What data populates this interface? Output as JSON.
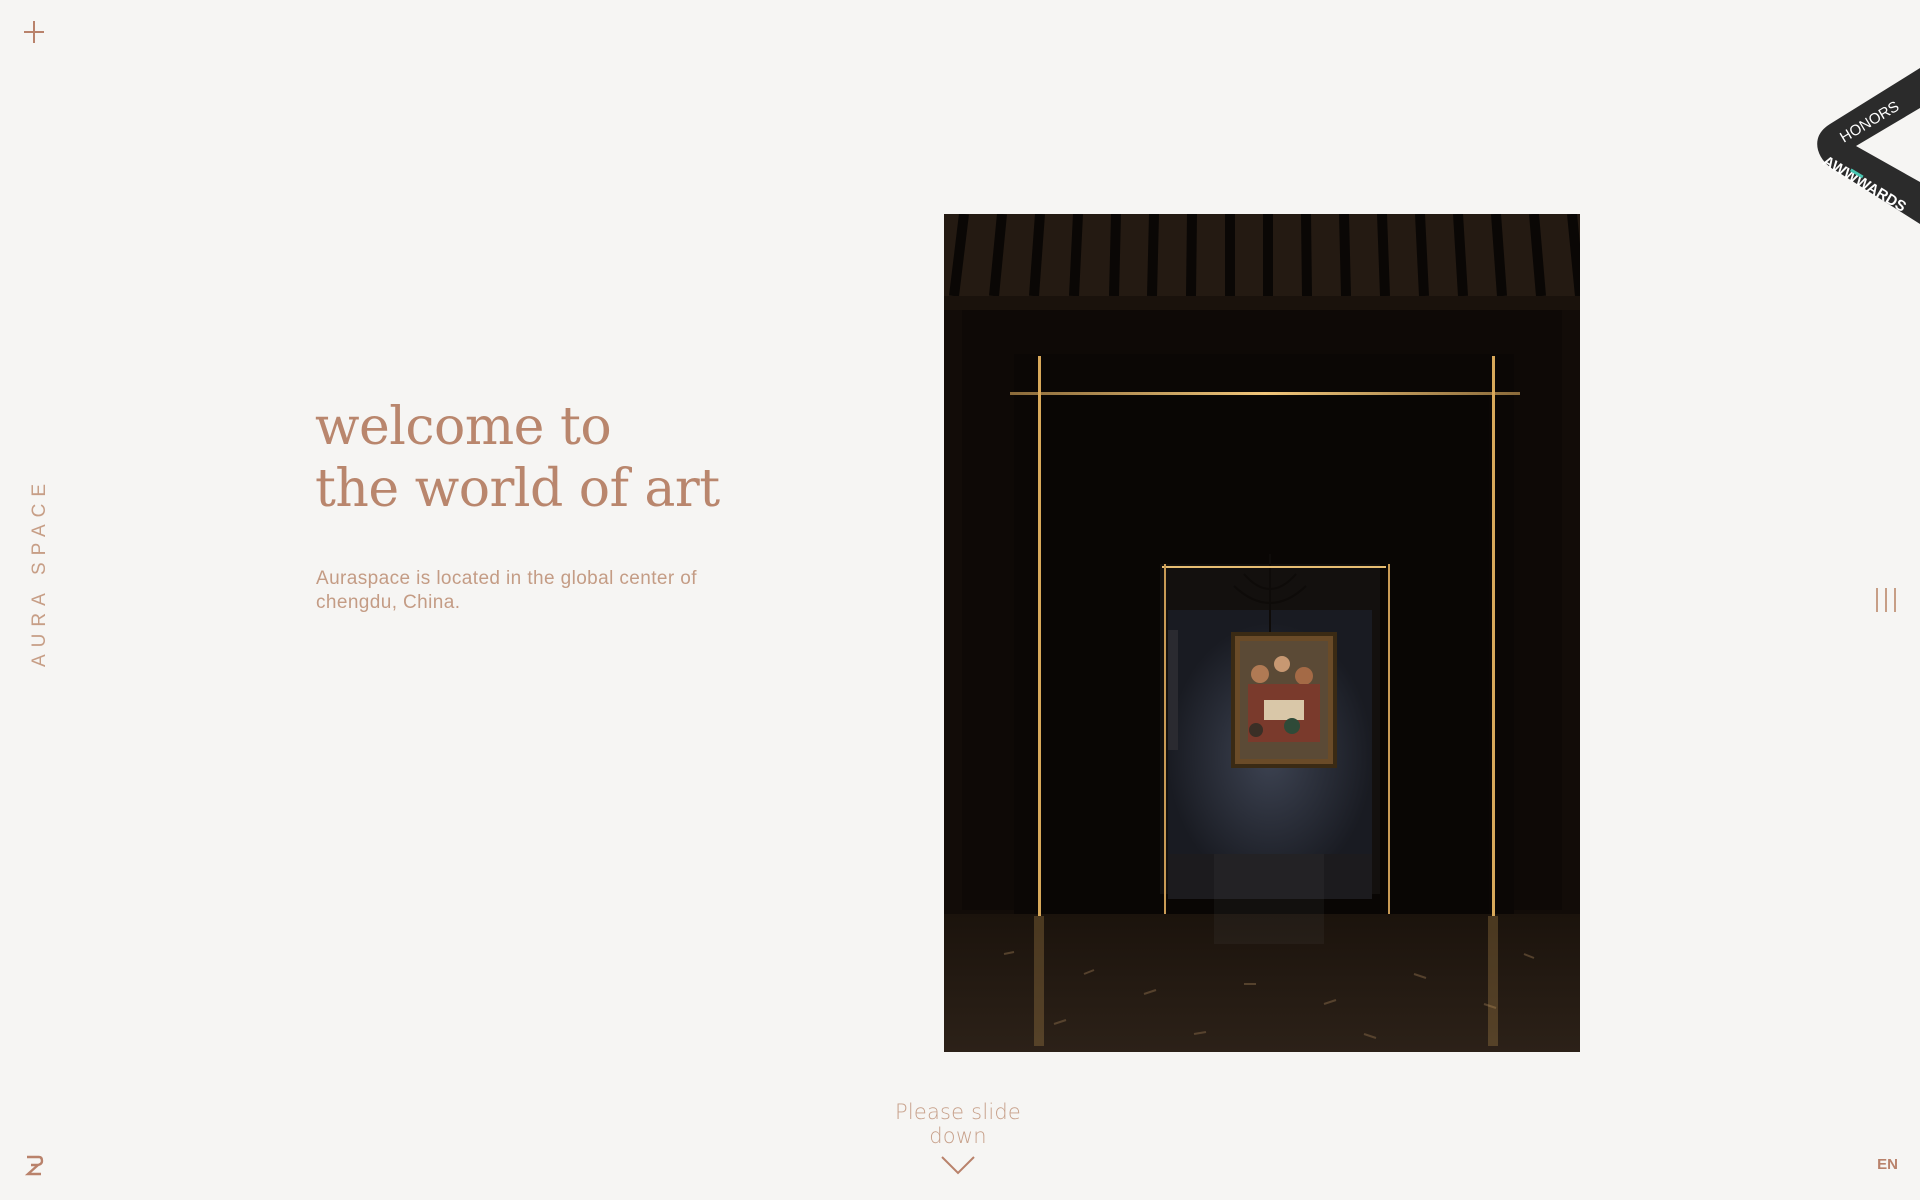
{
  "brand": {
    "side_label": "AURA SPACE"
  },
  "hero": {
    "title_line1": "welcome to",
    "title_line2": "the world of art",
    "description": "Auraspace is located in the global center of chengdu, China."
  },
  "badge": {
    "top_text": "HONORS",
    "bottom_text": "AWWWARDS"
  },
  "scroll": {
    "label": "Please slide down"
  },
  "footer": {
    "language": "EN"
  },
  "icons": {
    "menu": "plus-icon",
    "slides": "vertical-bars-icon",
    "scroll": "chevron-down-icon",
    "logo": "aura-logo-icon"
  },
  "colors": {
    "background": "#f6f5f3",
    "accent": "#b9866d",
    "image_dark": "#140e09",
    "light_gold": "#d8a85a"
  }
}
